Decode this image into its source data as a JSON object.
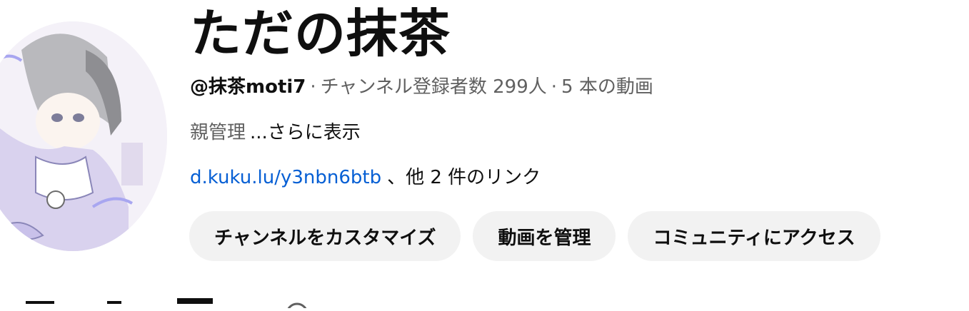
{
  "channel": {
    "name": "ただの抹茶",
    "handle": "@抹茶moti7",
    "separator": "·",
    "subscribers": "チャンネル登録者数 299人",
    "video_count": "5 本の動画",
    "description_preview": "親管理",
    "show_more": "...さらに表示",
    "link": "d.kuku.lu/y3nbn6btb",
    "more_links": "、他 2 件のリンク"
  },
  "buttons": {
    "customize": "チャンネルをカスタマイズ",
    "manage_videos": "動画を管理",
    "community": "コミュニティにアクセス"
  },
  "colors": {
    "link": "#065fd4",
    "button_bg": "#f2f2f2",
    "secondary_text": "#606060",
    "primary_text": "#0f0f0f"
  }
}
